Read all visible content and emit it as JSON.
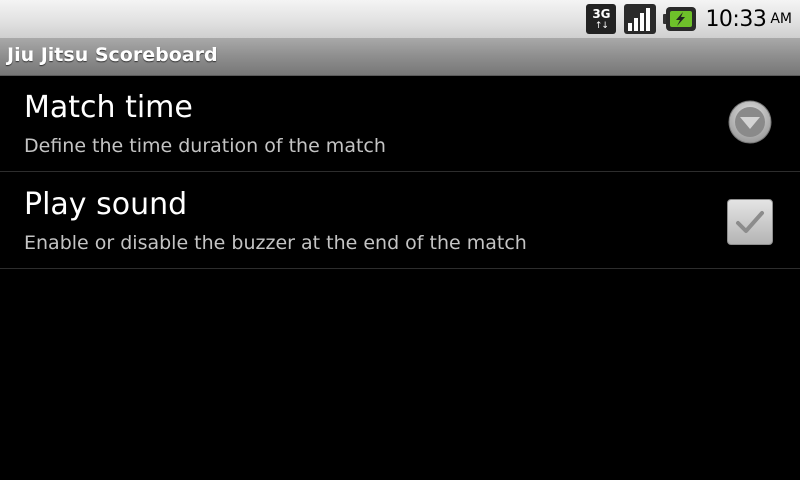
{
  "status_bar": {
    "network_type": "3G",
    "network_arrows": "↑↓",
    "time": "10:33",
    "ampm": "AM"
  },
  "app": {
    "title": "Jiu Jitsu Scoreboard"
  },
  "preferences": [
    {
      "title": "Match time",
      "summary": "Define the time duration of the match",
      "widget": "dropdown-icon"
    },
    {
      "title": "Play sound",
      "summary": "Enable or disable the buzzer at the end of the match",
      "widget": "checkbox",
      "checked": true
    }
  ],
  "colors": {
    "background": "#000000",
    "battery_accent": "#6ec02a"
  }
}
